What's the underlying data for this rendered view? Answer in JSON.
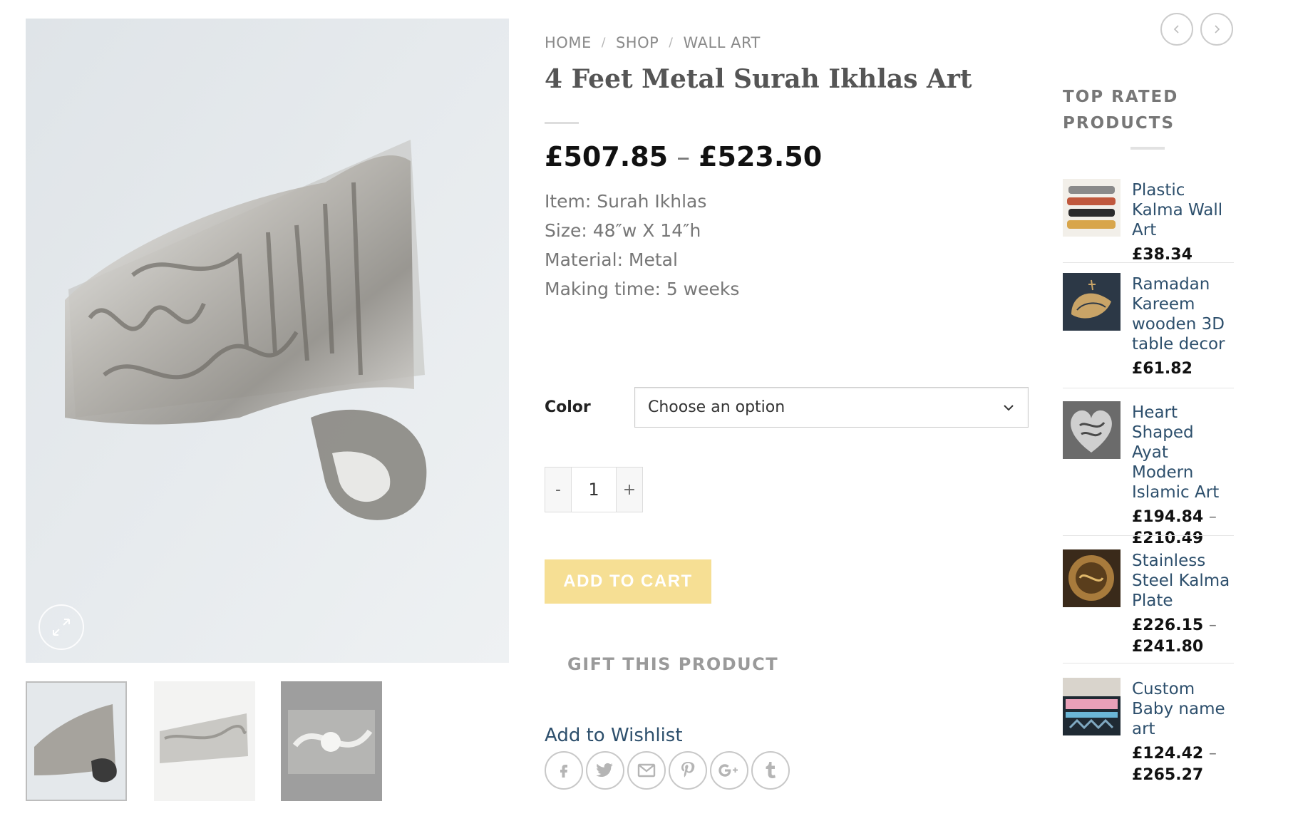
{
  "breadcrumb": {
    "home": "HOME",
    "shop": "SHOP",
    "category": "WALL ART",
    "separator": "/"
  },
  "product": {
    "title": "4 Feet Metal Surah Ikhlas Art",
    "price_low": "£507.85",
    "price_high": "£523.50",
    "price_dash": "–",
    "specs": {
      "item": "Item: Surah Ikhlas",
      "size": "Size: 48″w X 14″h",
      "material": "Material: Metal",
      "making_time": "Making time: 5 weeks"
    }
  },
  "variation": {
    "label": "Color",
    "selected": "Choose an option"
  },
  "quantity": {
    "minus": "-",
    "value": "1",
    "plus": "+"
  },
  "actions": {
    "add_to_cart": "ADD TO CART",
    "gift": "GIFT THIS PRODUCT",
    "wishlist": "Add to Wishlist"
  },
  "share_icons": [
    "facebook-icon",
    "twitter-icon",
    "email-icon",
    "pinterest-icon",
    "google-plus-icon",
    "tumblr-icon"
  ],
  "sidebar": {
    "title_line1": "TOP RATED",
    "title_line2": "PRODUCTS",
    "items": [
      {
        "name": "Plastic Kalma Wall Art",
        "price": "£38.34",
        "price_high": ""
      },
      {
        "name": "Ramadan Kareem wooden 3D table decor",
        "price": "£61.82",
        "price_high": ""
      },
      {
        "name": "Heart Shaped Ayat Modern Islamic Art",
        "price": "£194.84",
        "price_high": "£210.49"
      },
      {
        "name": "Stainless Steel Kalma Plate",
        "price": "£226.15",
        "price_high": "£241.80"
      },
      {
        "name": "Custom Baby name art",
        "price": "£124.42",
        "price_high": "£265.27"
      }
    ]
  },
  "colors": {
    "button_yellow": "#f6df94",
    "link_blue": "#2d4f6c",
    "price_black": "#111111"
  }
}
